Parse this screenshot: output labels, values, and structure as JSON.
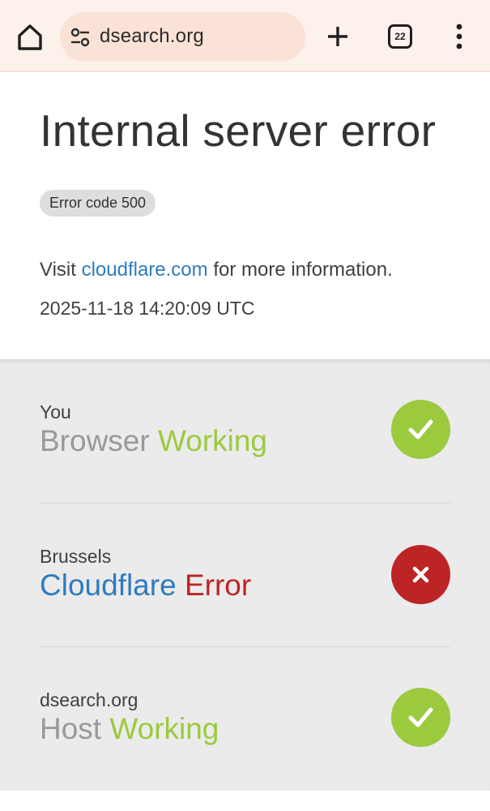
{
  "browser": {
    "url": "dsearch.org",
    "tab_count": "22"
  },
  "error": {
    "title": "Internal server error",
    "code_badge": "Error code 500",
    "visit_prefix": "Visit ",
    "visit_link": "cloudflare.com",
    "visit_suffix": " for more information.",
    "timestamp": "2025-11-18 14:20:09 UTC"
  },
  "status_rows": [
    {
      "location": "You",
      "name": "Browser",
      "status": "Working",
      "state": "ok"
    },
    {
      "location": "Brussels",
      "name": "Cloudflare",
      "status": "Error",
      "state": "error"
    },
    {
      "location": "dsearch.org",
      "name": "Host",
      "status": "Working",
      "state": "ok"
    }
  ],
  "colors": {
    "toolbar_bg": "#fdf1ec",
    "url_pill_bg": "#fbe2d6",
    "link_blue": "#2f7bbf",
    "ok_green": "#9bca3e",
    "error_red": "#bd2426",
    "status_bg": "#ebebeb"
  },
  "icons": [
    "home-icon",
    "tune-icon",
    "plus-icon",
    "tab-switcher-icon",
    "more-vert-icon",
    "check-icon",
    "close-icon"
  ]
}
